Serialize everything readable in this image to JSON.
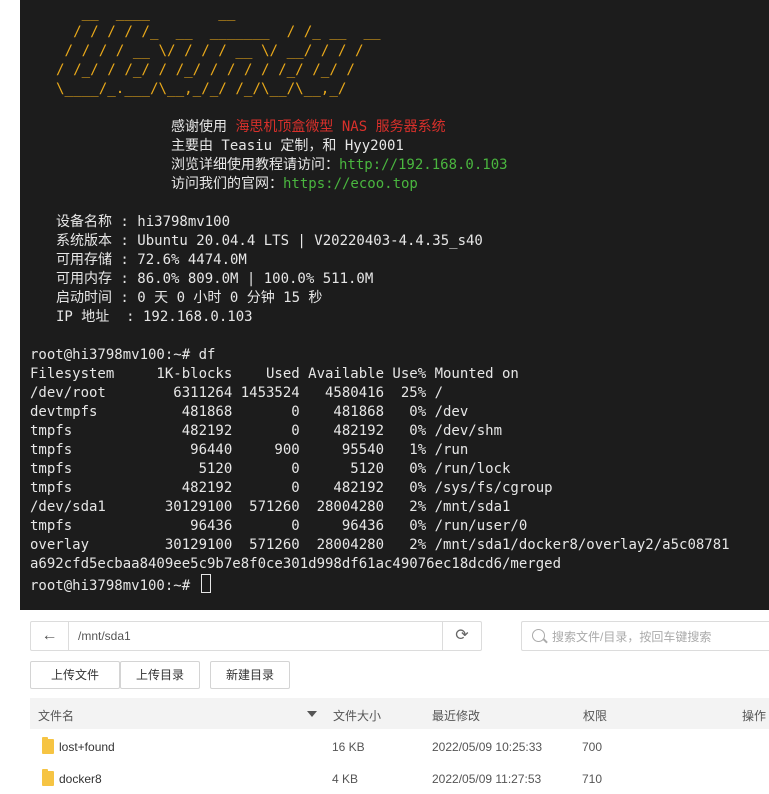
{
  "terminal": {
    "logo_ascii": "   __  ____        __\n  / / / / /_  __  _______  / /_ __  __\n / / / / __ \\/ / / / __ \\/ __/ / / /\n/ /_/ / /_/ / /_/ / / / / /_/ /_/ /\n\\____/_.___/\\__,_/_/ /_/\\__/\\__,_/",
    "welcome": {
      "line1_prefix": "感谢使用 ",
      "line1_highlight": "海思机顶盒微型 NAS 服务器系统",
      "line2": "主要由 Teasiu 定制，和 Hyy2001",
      "line3_prefix": "浏览详细使用教程请访问：",
      "line3_link": "http://192.168.0.103",
      "line4_prefix": "访问我们的官网：",
      "line4_link": "https://ecoo.top"
    },
    "sysinfo": [
      "设备名称 : hi3798mv100",
      "系统版本 : Ubuntu 20.04.4 LTS | V20220403-4.4.35_s40",
      "可用存储 : 72.6% 4474.0M",
      "可用内存 : 86.0% 809.0M | 100.0% 511.0M",
      "启动时间 : 0 天 0 小时 0 分钟 15 秒",
      "IP 地址  : 192.168.0.103"
    ],
    "prompt_command": "root@hi3798mv100:~# df",
    "df_header": "Filesystem     1K-blocks    Used Available Use% Mounted on",
    "df_rows": [
      "/dev/root        6311264 1453524   4580416  25% /",
      "devtmpfs          481868       0    481868   0% /dev",
      "tmpfs             482192       0    482192   0% /dev/shm",
      "tmpfs              96440     900     95540   1% /run",
      "tmpfs               5120       0      5120   0% /run/lock",
      "tmpfs             482192       0    482192   0% /sys/fs/cgroup",
      "/dev/sda1       30129100  571260  28004280   2% /mnt/sda1",
      "tmpfs              96436       0     96436   0% /run/user/0",
      "overlay         30129100  571260  28004280   2% /mnt/sda1/docker8/overlay2/a5c08781",
      "a692cfd5ecbaa8409ee5c9b7e8f0ce301d998df61ac49076ec18dcd6/merged"
    ],
    "final_prompt": "root@hi3798mv100:~# ",
    "colors": {
      "logo": "#e8a81a",
      "highlight": "#d8302b",
      "link": "#4ab63f"
    }
  },
  "file_manager": {
    "path": "/mnt/sda1",
    "back_icon": "←",
    "refresh_icon": "⟳",
    "search_placeholder": "搜索文件/目录，按回车键搜索",
    "buttons": {
      "upload_file": "上传文件",
      "upload_dir": "上传目录",
      "new_dir": "新建目录"
    },
    "columns": {
      "name": "文件名",
      "size": "文件大小",
      "modified": "最近修改",
      "perm": "权限",
      "actions": "操作"
    },
    "rows": [
      {
        "name": "lost+found",
        "size": "16 KB",
        "modified": "2022/05/09 10:25:33",
        "perm": "700"
      },
      {
        "name": "docker8",
        "size": "4 KB",
        "modified": "2022/05/09 11:27:53",
        "perm": "710"
      }
    ]
  }
}
